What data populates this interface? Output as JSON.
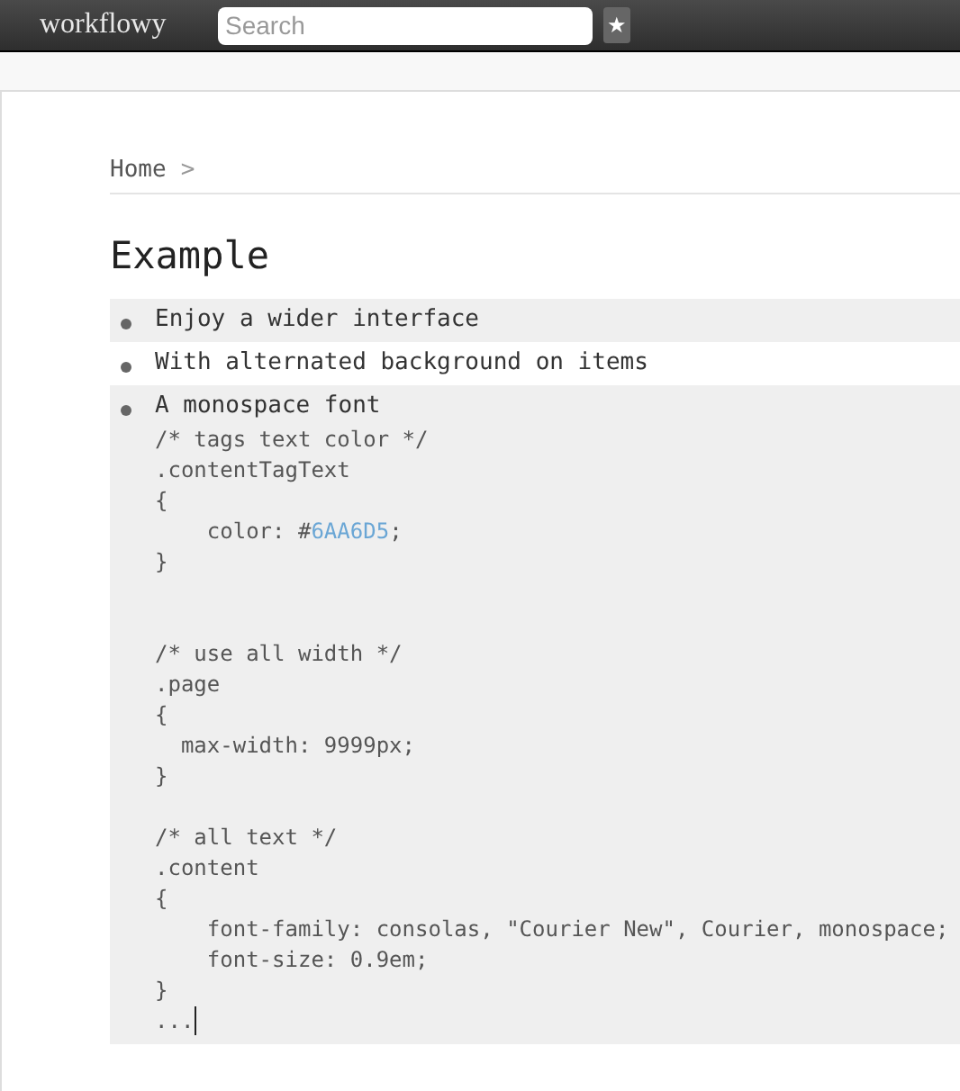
{
  "header": {
    "logo": "workflowy",
    "search": {
      "placeholder": "Search"
    },
    "star_button": "★"
  },
  "breadcrumb": {
    "items": [
      "Home"
    ],
    "separator": ">"
  },
  "title": "Example",
  "items": [
    {
      "text": "Enjoy a wider interface",
      "shaded": true,
      "cursor": false
    },
    {
      "text": "With alternated background on items",
      "shaded": false,
      "cursor": false
    },
    {
      "text": "A monospace font",
      "shaded": true,
      "cursor": true,
      "note": [
        {
          "kind": "text",
          "text": "/* tags text color */"
        },
        {
          "kind": "text",
          "text": ".contentTagText"
        },
        {
          "kind": "text",
          "text": "{"
        },
        {
          "kind": "tag",
          "text": "    color: #",
          "tag": "6AA6D5",
          "after": ";"
        },
        {
          "kind": "text",
          "text": "}"
        },
        {
          "kind": "blank"
        },
        {
          "kind": "blank"
        },
        {
          "kind": "text",
          "text": "/* use all width */"
        },
        {
          "kind": "text",
          "text": ".page"
        },
        {
          "kind": "text",
          "text": "{"
        },
        {
          "kind": "text",
          "text": "  max-width: 9999px;"
        },
        {
          "kind": "text",
          "text": "}"
        },
        {
          "kind": "blank"
        },
        {
          "kind": "text",
          "text": "/* all text */"
        },
        {
          "kind": "text",
          "text": ".content"
        },
        {
          "kind": "text",
          "text": "{"
        },
        {
          "kind": "text",
          "text": "    font-family: consolas, \"Courier New\", Courier, monospace;"
        },
        {
          "kind": "text",
          "text": "    font-size: 0.9em;"
        },
        {
          "kind": "text",
          "text": "}"
        },
        {
          "kind": "text",
          "text": "..."
        }
      ]
    }
  ]
}
